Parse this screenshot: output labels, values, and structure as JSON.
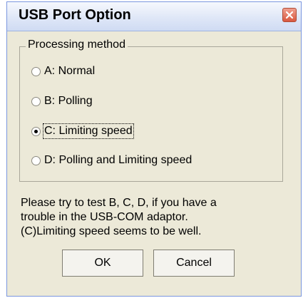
{
  "window": {
    "title": "USB Port Option",
    "close_icon": "close-icon"
  },
  "group": {
    "label": "Processing method",
    "options": [
      {
        "label": "A: Normal",
        "checked": false
      },
      {
        "label": "B: Polling",
        "checked": false
      },
      {
        "label": "C: Limiting speed",
        "checked": true
      },
      {
        "label": "D: Polling and Limiting speed",
        "checked": false
      }
    ]
  },
  "message": {
    "line1": "Please try to test B, C, D, if you have a",
    "line2": "trouble in the USB-COM adaptor.",
    "line3": "(C)Limiting speed seems to be well."
  },
  "buttons": {
    "ok_label": "OK",
    "cancel_label": "Cancel"
  },
  "colors": {
    "dialog_bg": "#ece9d8",
    "close_button": "#d9583f"
  }
}
